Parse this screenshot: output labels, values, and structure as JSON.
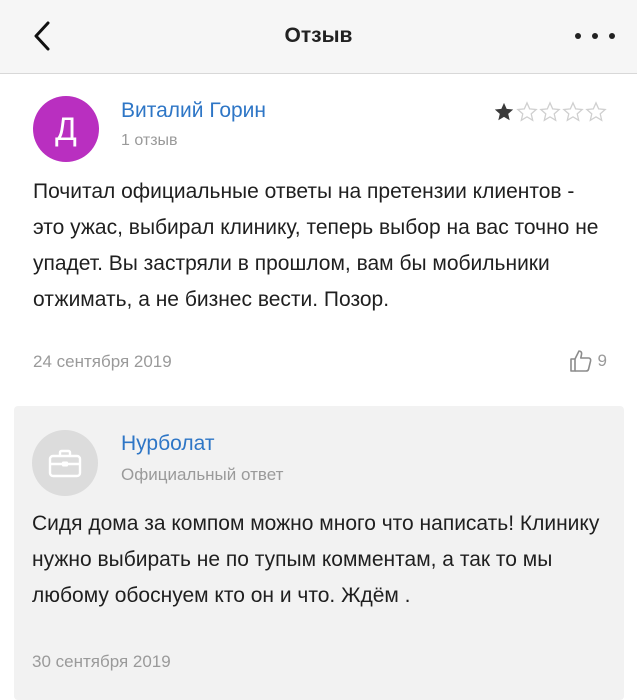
{
  "header": {
    "title": "Отзыв",
    "back_icon": "chevron-left-icon",
    "more_icon": "more-horizontal-icon"
  },
  "review": {
    "avatar_letter": "Д",
    "avatar_color": "#b92fc0",
    "author": "Виталий Горин",
    "reviews_count": "1 отзыв",
    "rating": 1,
    "rating_max": 5,
    "text": "Почитал официальные ответы на претензии клиентов - это ужас, выбирал клинику, теперь выбор на вас точно не упадет. Вы застряли в прошлом, вам бы мобильники отжимать, а не бизнес вести. Позор.",
    "date": "24 сентября 2019",
    "likes": "9",
    "like_icon": "thumbs-up-icon"
  },
  "reply": {
    "author": "Нурболат",
    "role": "Официальный ответ",
    "avatar_icon": "briefcase-icon",
    "text": "Сидя дома за компом можно много что написать! Клинику нужно выбирать не по тупым комментам, а так то мы любому обоснуем кто он и что. Ждём .",
    "date": "30 сентября 2019"
  },
  "colors": {
    "link": "#2e76c6",
    "muted": "#9a9a9a",
    "star_filled": "#3a3a3a",
    "star_empty": "#cfcfcf"
  }
}
